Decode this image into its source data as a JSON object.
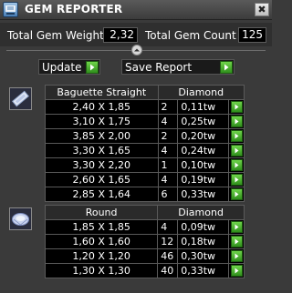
{
  "window": {
    "title": "GEM REPORTER",
    "close_label": "✖",
    "icon": "gem-reporter-app-icon"
  },
  "summary": {
    "weight_label": "Total Gem Weight",
    "weight_value": "2,32",
    "count_label": "Total Gem Count",
    "count_value": "125"
  },
  "toolbar": {
    "update_label": "Update",
    "save_label": "Save Report"
  },
  "groups": [
    {
      "icon": "baguette-gem-icon",
      "header": {
        "shape": "Baguette Straight",
        "type": "Diamond"
      },
      "rows": [
        {
          "size": "2,40 X 1,85",
          "qty": "2",
          "carats": "0,11tw"
        },
        {
          "size": "3,10 X 1,75",
          "qty": "4",
          "carats": "0,25tw"
        },
        {
          "size": "3,85 X 2,00",
          "qty": "2",
          "carats": "0,20tw"
        },
        {
          "size": "3,30 X 1,65",
          "qty": "4",
          "carats": "0,24tw"
        },
        {
          "size": "3,30 X 2,20",
          "qty": "1",
          "carats": "0,10tw"
        },
        {
          "size": "2,60 X 1,65",
          "qty": "4",
          "carats": "0,19tw"
        },
        {
          "size": "2,85 X 1,64",
          "qty": "6",
          "carats": "0,33tw"
        }
      ]
    },
    {
      "icon": "round-gem-icon",
      "header": {
        "shape": "Round",
        "type": "Diamond"
      },
      "rows": [
        {
          "size": "1,85 X 1,85",
          "qty": "4",
          "carats": "0,09tw"
        },
        {
          "size": "1,60 X 1,60",
          "qty": "12",
          "carats": "0,18tw"
        },
        {
          "size": "1,20 X 1,20",
          "qty": "46",
          "carats": "0,30tw"
        },
        {
          "size": "1,30 X 1,30",
          "qty": "40",
          "carats": "0,33tw"
        }
      ]
    }
  ]
}
